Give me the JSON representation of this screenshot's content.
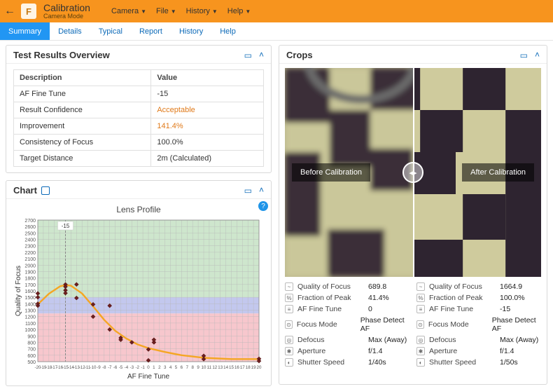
{
  "app": {
    "title": "Calibration",
    "subtitle": "Camera Mode",
    "topmenu": [
      "Camera",
      "File",
      "History",
      "Help"
    ]
  },
  "tabs": [
    "Summary",
    "Details",
    "Typical",
    "Report",
    "History",
    "Help"
  ],
  "activeTab": "Summary",
  "panels": {
    "results": {
      "title": "Test Results Overview",
      "headers": [
        "Description",
        "Value"
      ],
      "rows": [
        {
          "k": "AF Fine Tune",
          "v": "-15",
          "cls": ""
        },
        {
          "k": "Result Confidence",
          "v": "Acceptable",
          "cls": "v-orange"
        },
        {
          "k": "Improvement",
          "v": "141.4%",
          "cls": "v-orange"
        },
        {
          "k": "Consistency of Focus",
          "v": "100.0%",
          "cls": ""
        },
        {
          "k": "Target Distance",
          "v": "2m (Calculated)",
          "cls": ""
        }
      ]
    },
    "chart": {
      "title": "Chart"
    },
    "crops": {
      "title": "Crops",
      "before_label": "Before Calibration",
      "after_label": "After Calibration",
      "before": [
        {
          "icon": "~",
          "k": "Quality of Focus",
          "v": "689.8"
        },
        {
          "icon": "%",
          "k": "Fraction of Peak",
          "v": "41.4%"
        },
        {
          "icon": "≡",
          "k": "AF Fine Tune",
          "v": "0"
        },
        {
          "icon": "⊙",
          "k": "Focus Mode",
          "v": "Phase Detect AF"
        },
        {
          "icon": "◎",
          "k": "Defocus",
          "v": "Max (Away)"
        },
        {
          "icon": "✱",
          "k": "Aperture",
          "v": "f/1.4"
        },
        {
          "icon": "◐",
          "k": "Shutter Speed",
          "v": "1/40s"
        }
      ],
      "after": [
        {
          "icon": "~",
          "k": "Quality of Focus",
          "v": "1664.9"
        },
        {
          "icon": "%",
          "k": "Fraction of Peak",
          "v": "100.0%"
        },
        {
          "icon": "≡",
          "k": "AF Fine Tune",
          "v": "-15"
        },
        {
          "icon": "⊙",
          "k": "Focus Mode",
          "v": "Phase Detect AF"
        },
        {
          "icon": "◎",
          "k": "Defocus",
          "v": "Max (Away)"
        },
        {
          "icon": "✱",
          "k": "Aperture",
          "v": "f/1.4"
        },
        {
          "icon": "◐",
          "k": "Shutter Speed",
          "v": "1/50s"
        }
      ]
    }
  },
  "chart_data": {
    "type": "scatter",
    "title": "Lens Profile",
    "xlabel": "AF Fine Tune",
    "ylabel": "Quality of Focus",
    "xlim": [
      -20,
      20
    ],
    "ylim": [
      500,
      2700
    ],
    "xticks": [
      -20,
      -19,
      -18,
      -17,
      -16,
      -15,
      -14,
      -13,
      -12,
      -11,
      -10,
      -9,
      -8,
      -7,
      -6,
      -5,
      -4,
      -3,
      -2,
      -1,
      0,
      1,
      2,
      3,
      4,
      5,
      6,
      7,
      8,
      9,
      10,
      11,
      12,
      13,
      14,
      15,
      16,
      17,
      18,
      19,
      20
    ],
    "yticks": [
      500,
      600,
      700,
      800,
      900,
      1000,
      1100,
      1200,
      1300,
      1400,
      1500,
      1600,
      1700,
      1800,
      1900,
      2000,
      2100,
      2200,
      2300,
      2400,
      2500,
      2600,
      2700
    ],
    "marker_line": -15,
    "bands": [
      {
        "from": 500,
        "to": 1250,
        "color": "pink"
      },
      {
        "from": 1250,
        "to": 1500,
        "color": "blue"
      },
      {
        "from": 1500,
        "to": 2700,
        "color": "green"
      }
    ],
    "points": [
      {
        "x": -20,
        "y": 1500
      },
      {
        "x": -20,
        "y": 1560
      },
      {
        "x": -20,
        "y": 1370
      },
      {
        "x": -20,
        "y": 1400
      },
      {
        "x": -15,
        "y": 1700
      },
      {
        "x": -15,
        "y": 1610
      },
      {
        "x": -15,
        "y": 1665
      },
      {
        "x": -15,
        "y": 1565
      },
      {
        "x": -13,
        "y": 1700
      },
      {
        "x": -13,
        "y": 1490
      },
      {
        "x": -10,
        "y": 1200
      },
      {
        "x": -10,
        "y": 1390
      },
      {
        "x": -7,
        "y": 1000
      },
      {
        "x": -7,
        "y": 1370
      },
      {
        "x": -5,
        "y": 840
      },
      {
        "x": -5,
        "y": 870
      },
      {
        "x": -3,
        "y": 800
      },
      {
        "x": 0,
        "y": 520
      },
      {
        "x": 0,
        "y": 690
      },
      {
        "x": 1,
        "y": 800
      },
      {
        "x": 1,
        "y": 840
      },
      {
        "x": 10,
        "y": 590
      },
      {
        "x": 10,
        "y": 540
      },
      {
        "x": 20,
        "y": 545
      },
      {
        "x": 20,
        "y": 510
      }
    ],
    "fit": [
      {
        "x": -20,
        "y": 1390
      },
      {
        "x": -18,
        "y": 1555
      },
      {
        "x": -16,
        "y": 1670
      },
      {
        "x": -15,
        "y": 1690
      },
      {
        "x": -14,
        "y": 1680
      },
      {
        "x": -12,
        "y": 1560
      },
      {
        "x": -10,
        "y": 1360
      },
      {
        "x": -8,
        "y": 1150
      },
      {
        "x": -6,
        "y": 980
      },
      {
        "x": -4,
        "y": 860
      },
      {
        "x": -2,
        "y": 770
      },
      {
        "x": 0,
        "y": 710
      },
      {
        "x": 3,
        "y": 650
      },
      {
        "x": 6,
        "y": 600
      },
      {
        "x": 10,
        "y": 560
      },
      {
        "x": 15,
        "y": 540
      },
      {
        "x": 20,
        "y": 540
      }
    ]
  }
}
